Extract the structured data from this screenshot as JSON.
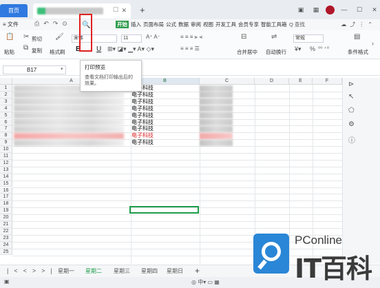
{
  "titlebar": {
    "home_tab": "首页",
    "new_tab_symbol": "+",
    "close_symbol": "✕"
  },
  "menu": {
    "file": "≡ 文件",
    "tabs": [
      "开始",
      "插入",
      "页面布局",
      "公式",
      "数据",
      "审阅",
      "视图",
      "开发工具",
      "会员专享",
      "智能工具箱"
    ],
    "active_tab": "开始",
    "search": "Q 查找"
  },
  "ribbon": {
    "paste": "粘贴",
    "cut": "剪切",
    "copy": "复制",
    "format_painter": "格式刷",
    "font": "宋体",
    "font_size": "11",
    "bold": "B",
    "underline": "U",
    "merge_center": "合并居中",
    "wrap_text": "自动换行",
    "number_format": "常规",
    "condition_format": "条件格式",
    "percent": "%"
  },
  "tooltip": {
    "title": "打印预览",
    "description": "查看文档打印输出后的效果。"
  },
  "namebox": {
    "value": "B17"
  },
  "grid": {
    "columns": [
      "A",
      "B",
      "C",
      "D",
      "E",
      "F"
    ],
    "rows": [
      "1",
      "2",
      "3",
      "4",
      "5",
      "6",
      "7",
      "8",
      "9",
      "10",
      "11",
      "12",
      "13",
      "14",
      "15",
      "16",
      "17",
      "18",
      "19",
      "20",
      "21",
      "22",
      "23",
      "24",
      "25"
    ],
    "col_b_values": [
      "电子科技",
      "电子科技",
      "电子科技",
      "电子科技",
      "电子科技",
      "电子科技",
      "电子科技",
      "电子科技",
      "电子科技"
    ],
    "highlight_row_index": 7
  },
  "sheets": {
    "tabs": [
      "星期一",
      "星期二",
      "星期三",
      "星期四",
      "星期日"
    ],
    "active": "星期二",
    "add": "+"
  },
  "watermark": {
    "brand_top": "PConline",
    "brand_bottom": "IT百科"
  },
  "colors": {
    "accent_green": "#1e9c4a",
    "highlight_red": "#e02525",
    "home_blue": "#2f79e0"
  }
}
